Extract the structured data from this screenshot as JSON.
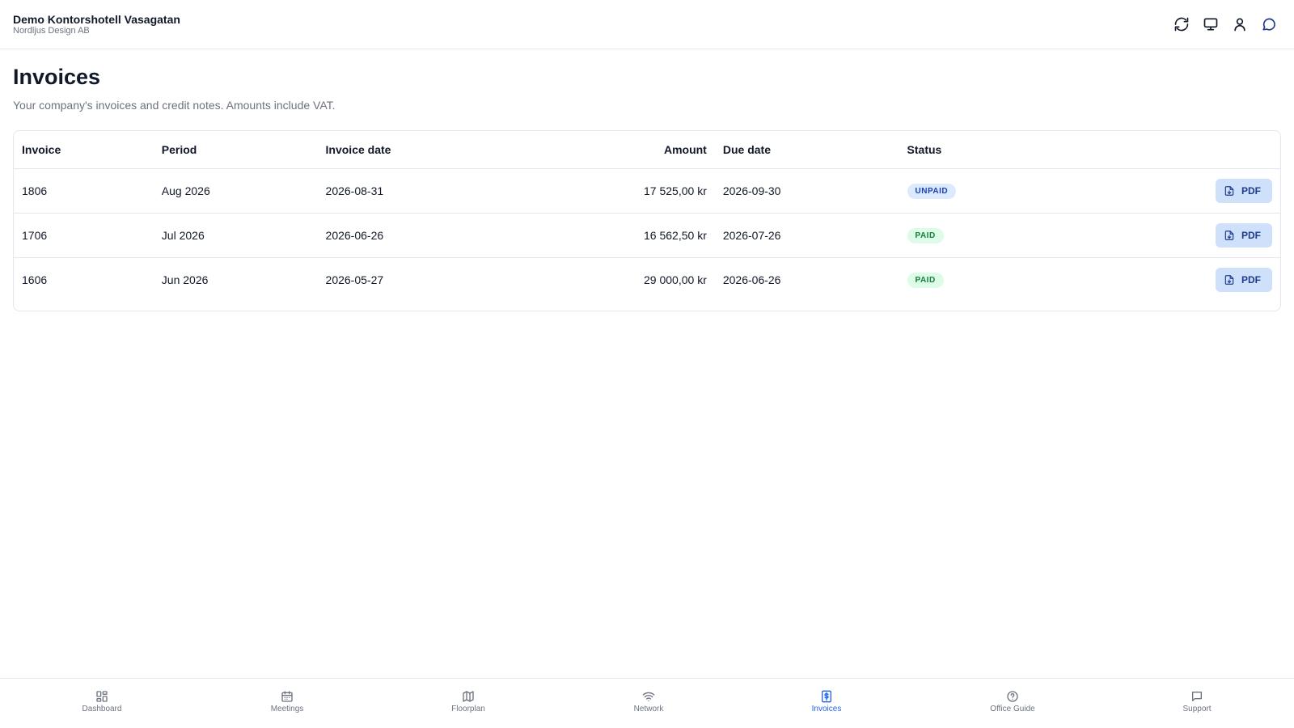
{
  "header": {
    "title": "Demo Kontorshotell Vasagatan",
    "subtitle": "Nordljus Design AB",
    "icons": [
      "refresh-icon",
      "monitor-icon",
      "user-icon",
      "chat-icon"
    ]
  },
  "page": {
    "title": "Invoices",
    "description": "Your company's invoices and credit notes. Amounts include VAT."
  },
  "table": {
    "columns": {
      "invoice": "Invoice",
      "period": "Period",
      "invoice_date": "Invoice date",
      "amount": "Amount",
      "due_date": "Due date",
      "status": "Status"
    },
    "rows": [
      {
        "invoice": "1806",
        "period": "Aug 2026",
        "invoice_date": "2026-08-31",
        "amount": "17 525,00 kr",
        "due_date": "2026-09-30",
        "status": "UNPAID",
        "pdf_label": "PDF"
      },
      {
        "invoice": "1706",
        "period": "Jul 2026",
        "invoice_date": "2026-06-26",
        "amount": "16 562,50 kr",
        "due_date": "2026-07-26",
        "status": "PAID",
        "pdf_label": "PDF"
      },
      {
        "invoice": "1606",
        "period": "Jun 2026",
        "invoice_date": "2026-05-27",
        "amount": "29 000,00 kr",
        "due_date": "2026-06-26",
        "status": "PAID",
        "pdf_label": "PDF"
      }
    ]
  },
  "nav": {
    "active": "Invoices",
    "active_color": "#2563eb",
    "items": [
      {
        "label": "Dashboard",
        "icon": "dashboard-icon"
      },
      {
        "label": "Meetings",
        "icon": "calendar-icon"
      },
      {
        "label": "Floorplan",
        "icon": "map-icon"
      },
      {
        "label": "Network",
        "icon": "wifi-icon"
      },
      {
        "label": "Invoices",
        "icon": "invoice-icon"
      },
      {
        "label": "Office Guide",
        "icon": "help-icon"
      },
      {
        "label": "Support",
        "icon": "support-icon"
      }
    ]
  },
  "colors": {
    "unpaid_badge_bg": "#dbeafe",
    "unpaid_badge_text": "#1e40af",
    "paid_badge_bg": "#dcfce7",
    "paid_badge_text": "#15803d",
    "pdf_button_bg": "#cfe0fb"
  }
}
